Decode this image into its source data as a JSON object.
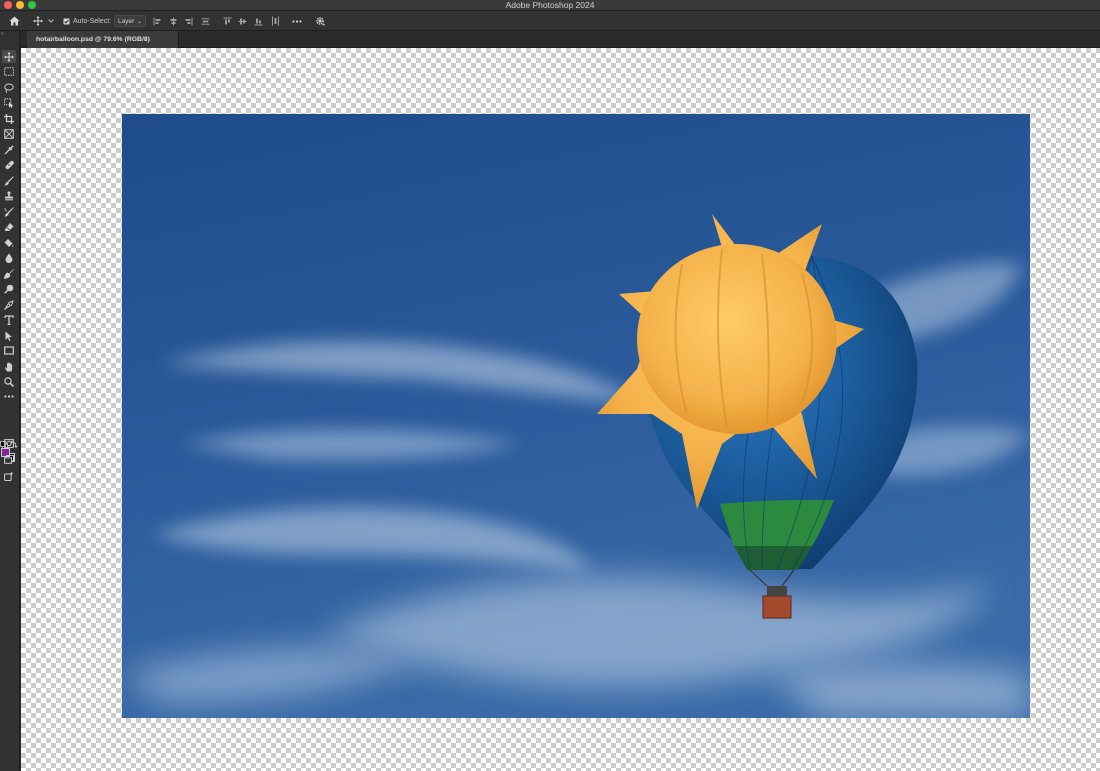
{
  "window": {
    "title": "Adobe Photoshop 2024"
  },
  "options_bar": {
    "auto_select_label": "Auto-Select:",
    "auto_select_checked": true,
    "auto_select_target": "Layer",
    "icons": [
      "home-icon",
      "move-tool-icon",
      "chevron-down-icon",
      "align-left-edges-icon",
      "align-horizontal-centers-icon",
      "align-right-edges-icon",
      "distribute-icon",
      "align-top-edges-icon",
      "align-vertical-centers-icon",
      "align-bottom-edges-icon",
      "distribute-vertical-icon",
      "more-options-icon",
      "gear-icon"
    ]
  },
  "document": {
    "tab_label": "hotairballoon.psd @ 79.6% (RGB/8)"
  },
  "tools": [
    "move",
    "rectangular-marquee",
    "lasso",
    "object-selection",
    "crop",
    "frame",
    "eyedropper",
    "spot-healing-brush",
    "brush",
    "clone-stamp",
    "history-brush",
    "eraser",
    "paint-bucket",
    "blur",
    "smudge",
    "dodge",
    "pen",
    "type",
    "path-selection",
    "rectangle",
    "hand",
    "zoom",
    "edit-toolbar",
    "quick-mask",
    "screen-mode",
    "generative-fill"
  ],
  "colors": {
    "foreground": "#8b1fa6",
    "background": "#000000",
    "sky": "#2c5a9a",
    "balloon_sun": "#f4b54a",
    "balloon_envelope": "#1d5fa0",
    "balloon_band": "#2b8a3e"
  }
}
